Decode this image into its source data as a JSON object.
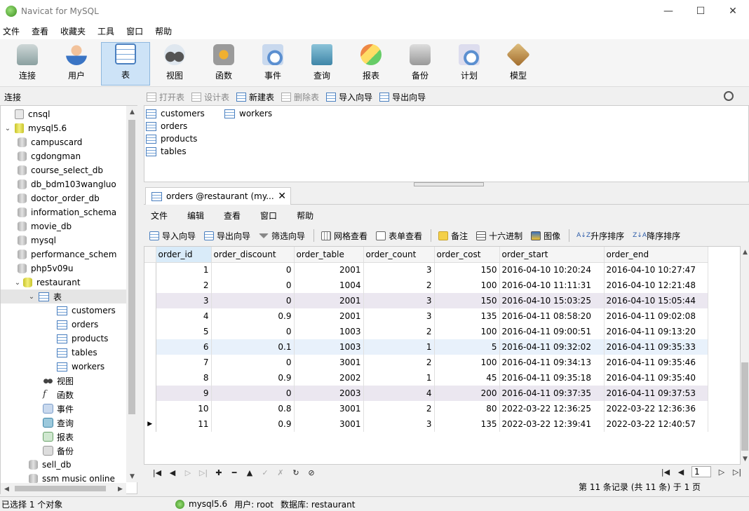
{
  "window": {
    "title": "Navicat for MySQL",
    "controls": [
      "—",
      "☐",
      "✕"
    ]
  },
  "menubar": [
    "文件",
    "查看",
    "收藏夹",
    "工具",
    "窗口",
    "帮助"
  ],
  "toolbar": [
    {
      "label": "连接",
      "icon": "connect-icon"
    },
    {
      "label": "用户",
      "icon": "user-icon"
    },
    {
      "label": "表",
      "icon": "table-icon",
      "active": true
    },
    {
      "label": "视图",
      "icon": "view-icon"
    },
    {
      "label": "函数",
      "icon": "function-icon"
    },
    {
      "label": "事件",
      "icon": "event-icon"
    },
    {
      "label": "查询",
      "icon": "query-icon"
    },
    {
      "label": "报表",
      "icon": "report-icon"
    },
    {
      "label": "备份",
      "icon": "backup-icon"
    },
    {
      "label": "计划",
      "icon": "schedule-icon"
    },
    {
      "label": "模型",
      "icon": "model-icon"
    }
  ],
  "connections_header": "连接",
  "tree": {
    "cnsql": "cnsql",
    "mysql56": "mysql5.6",
    "databases_before": [
      "campuscard",
      "cgdongman",
      "course_select_db",
      "db_bdm103wangluo",
      "doctor_order_db",
      "information_schema",
      "movie_db",
      "mysql",
      "performance_schem",
      "php5v09u"
    ],
    "restaurant": "restaurant",
    "tables_node": "表",
    "tables": [
      "customers",
      "orders",
      "products",
      "tables",
      "workers"
    ],
    "objects": [
      "视图",
      "函数",
      "事件",
      "查询",
      "报表",
      "备份"
    ],
    "databases_after": [
      "sell_db",
      "ssm music online"
    ]
  },
  "object_toolbar": {
    "open": "打开表",
    "design": "设计表",
    "new": "新建表",
    "delete": "删除表",
    "import": "导入向导",
    "export": "导出向导"
  },
  "object_list": [
    "customers",
    "orders",
    "products",
    "tables",
    "workers"
  ],
  "tab": {
    "label": "orders @restaurant (my...",
    "close": "✕"
  },
  "inner_menu": [
    "文件",
    "编辑",
    "查看",
    "窗口",
    "帮助"
  ],
  "inner_toolbar": {
    "import": "导入向导",
    "export": "导出向导",
    "filter": "筛选向导",
    "grid_view": "网格查看",
    "form_view": "表单查看",
    "memo": "备注",
    "hex": "十六进制",
    "image": "图像",
    "sort_asc": "升序排序",
    "sort_desc": "降序排序",
    "sort_asc_glyph": "A↓Z",
    "sort_desc_glyph": "Z↓A"
  },
  "grid": {
    "columns": [
      "order_id",
      "order_discount",
      "order_table",
      "order_count",
      "order_cost",
      "order_start",
      "order_end"
    ],
    "rows": [
      [
        "1",
        "0",
        "2001",
        "3",
        "150",
        "2016-04-10 10:20:24",
        "2016-04-10 10:27:47"
      ],
      [
        "2",
        "0",
        "1004",
        "2",
        "100",
        "2016-04-10 11:11:31",
        "2016-04-10 12:21:48"
      ],
      [
        "3",
        "0",
        "2001",
        "3",
        "150",
        "2016-04-10 15:03:25",
        "2016-04-10 15:05:44"
      ],
      [
        "4",
        "0.9",
        "2001",
        "3",
        "135",
        "2016-04-11 08:58:20",
        "2016-04-11 09:02:08"
      ],
      [
        "5",
        "0",
        "1003",
        "2",
        "100",
        "2016-04-11 09:00:51",
        "2016-04-11 09:13:20"
      ],
      [
        "6",
        "0.1",
        "1003",
        "1",
        "5",
        "2016-04-11 09:32:02",
        "2016-04-11 09:35:33"
      ],
      [
        "7",
        "0",
        "3001",
        "2",
        "100",
        "2016-04-11 09:34:13",
        "2016-04-11 09:35:46"
      ],
      [
        "8",
        "0.9",
        "2002",
        "1",
        "45",
        "2016-04-11 09:35:18",
        "2016-04-11 09:35:40"
      ],
      [
        "9",
        "0",
        "2003",
        "4",
        "200",
        "2016-04-11 09:37:35",
        "2016-04-11 09:37:53"
      ],
      [
        "10",
        "0.8",
        "3001",
        "2",
        "80",
        "2022-03-22 12:36:25",
        "2022-03-22 12:36:36"
      ],
      [
        "11",
        "0.9",
        "3001",
        "3",
        "135",
        "2022-03-22 12:39:41",
        "2022-03-22 12:40:57"
      ]
    ],
    "current_row_marker": "▶"
  },
  "navigator": {
    "buttons": [
      "|◀",
      "◀",
      "▷",
      "▷|",
      "✚",
      "━",
      "▲",
      "✓",
      "✗",
      "↻",
      "⊘"
    ],
    "page_value": "1",
    "record_info": "第 11 条记录 (共 11 条) 于 1 页"
  },
  "status": {
    "selection": "已选择 1 个对象",
    "connection": "mysql5.6",
    "user": "用户: root",
    "database": "数据库: restaurant"
  }
}
